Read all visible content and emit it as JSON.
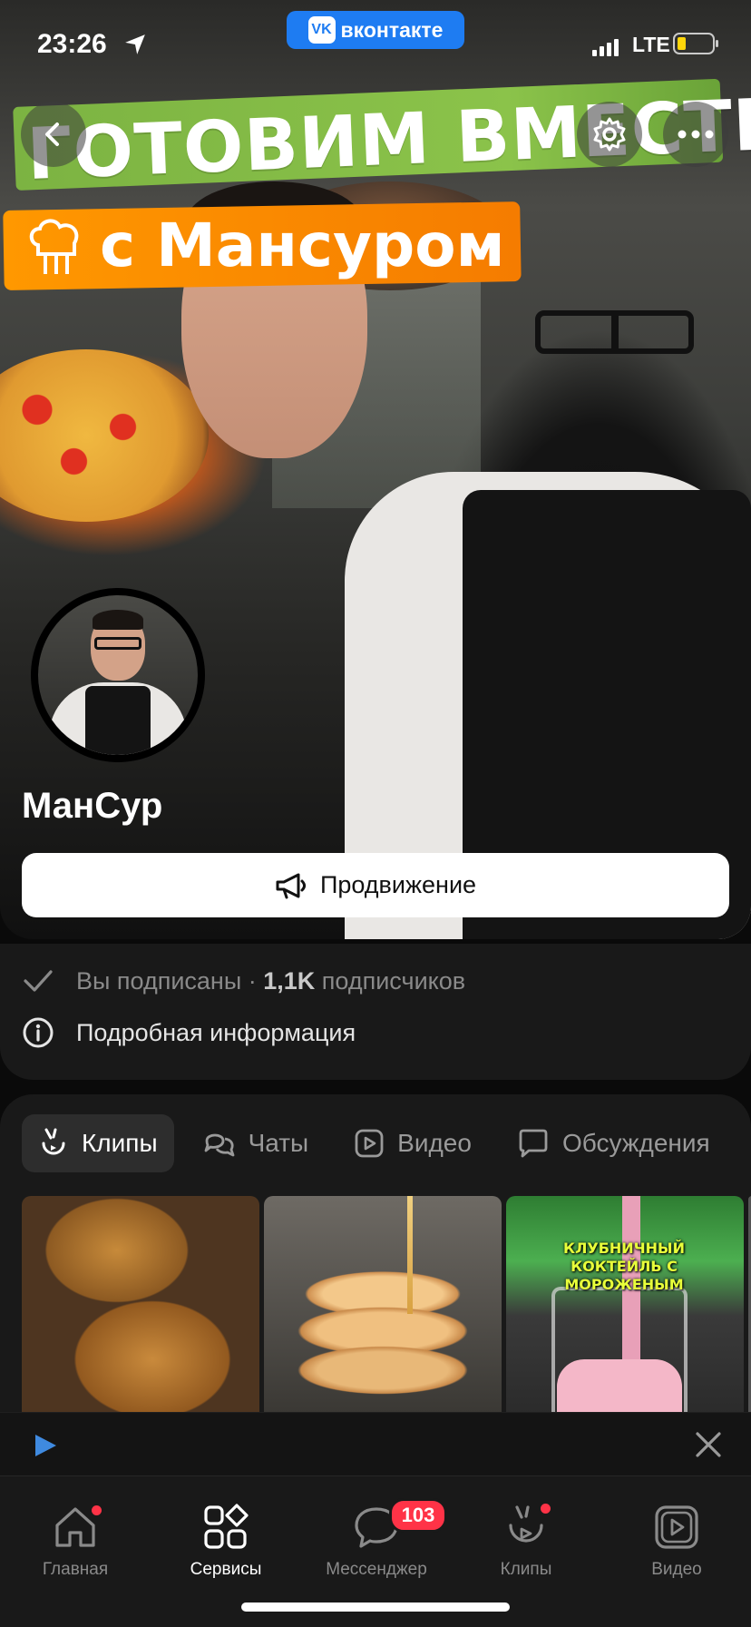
{
  "status_bar": {
    "time": "23:26",
    "app_pill": "вконтакте",
    "network": "LTE"
  },
  "cover": {
    "headline_top": "ГОТОВИМ ВМЕСТЕ",
    "headline_bottom": "с Мансуром"
  },
  "header_buttons": {
    "back": "back-icon",
    "settings": "gear-icon",
    "more": "more-icon"
  },
  "profile": {
    "name": "МанСур",
    "promo_button": "Продвижение"
  },
  "info": {
    "subscribed": "Вы подписаны",
    "separator": " · ",
    "subscribers": "1,1K",
    "subscribers_label": " подписчиков",
    "details": "Подробная информация"
  },
  "tabs": [
    {
      "label": "Клипы",
      "icon": "clips-icon",
      "active": true
    },
    {
      "label": "Чаты",
      "icon": "chats-icon",
      "active": false
    },
    {
      "label": "Видео",
      "icon": "video-icon",
      "active": false
    },
    {
      "label": "Обсуждения",
      "icon": "discussion-icon",
      "active": false
    }
  ],
  "clips": [
    {
      "caption": ""
    },
    {
      "caption": ""
    },
    {
      "caption": "КЛУБНИЧНЫЙ КОКТЕЙЛЬ С МОРОЖЕНЫМ"
    }
  ],
  "tabbar": [
    {
      "label": "Главная",
      "icon": "home-icon",
      "dot": true
    },
    {
      "label": "Сервисы",
      "icon": "services-icon",
      "active": true
    },
    {
      "label": "Мессенджер",
      "icon": "messenger-icon",
      "badge": "103"
    },
    {
      "label": "Клипы",
      "icon": "clips-icon",
      "dot": true
    },
    {
      "label": "Видео",
      "icon": "video-icon"
    }
  ],
  "colors": {
    "accent": "#1e7cf2",
    "badge": "#ff3347",
    "background": "#0a0a0a",
    "panel": "#191919"
  }
}
